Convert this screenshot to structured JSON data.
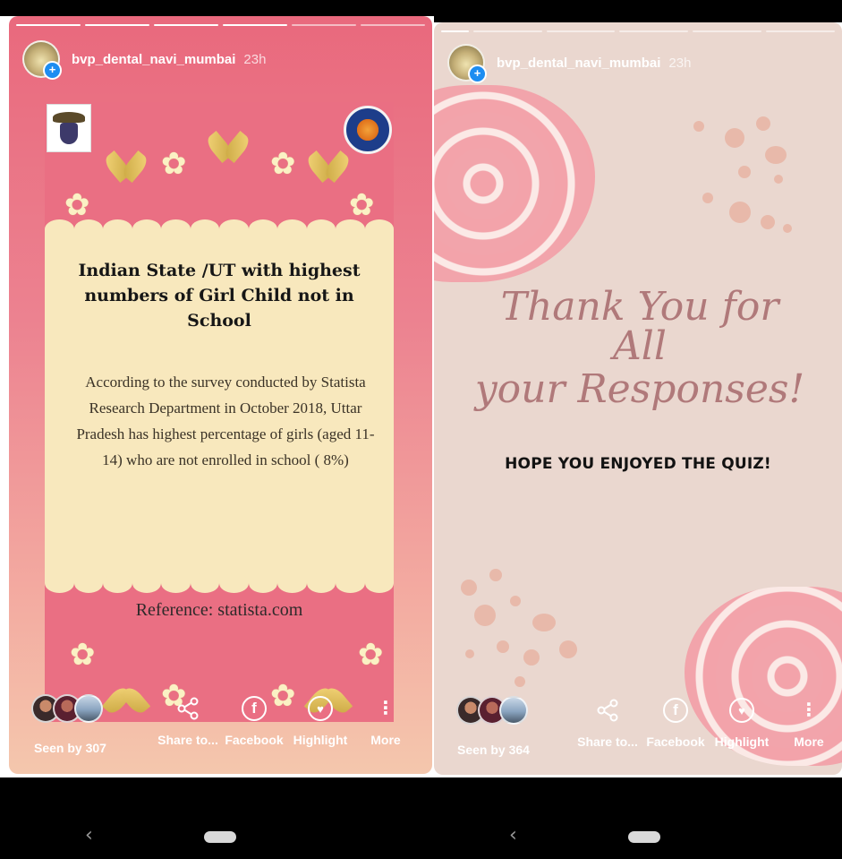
{
  "stories": [
    {
      "username": "bvp_dental_navi_mumbai",
      "time_ago": "23h",
      "poster": {
        "title": "Indian State /UT with highest numbers of Girl Child not in  School",
        "body_lines": [
          "According to the survey conducted by Statista",
          "Research Department in October 2018, Uttar",
          "Pradesh has highest percentage of girls (aged 11-",
          "14) who are not enrolled in school ( 8%)"
        ],
        "reference": "Reference: statista.com"
      },
      "seen_by": "Seen by 307",
      "actions": {
        "share": "Share to...",
        "facebook": "Facebook",
        "highlight": "Highlight",
        "more": "More"
      }
    },
    {
      "username": "bvp_dental_navi_mumbai",
      "time_ago": "23h",
      "message_line1": "Thank You for All",
      "message_line2": "your Responses!",
      "subtitle": "HOPE YOU ENJOYED THE  QUIZ!",
      "seen_by": "Seen by 364",
      "actions": {
        "share": "Share to...",
        "facebook": "Facebook",
        "highlight": "Highlight",
        "more": "More"
      }
    }
  ],
  "nav": {
    "back_glyph": "‹"
  },
  "colors": {
    "left_story_top": "#e9697d",
    "poster_pink": "#ea6f83",
    "poster_cream": "#f8e8bd",
    "right_story_bg": "#ead7cf",
    "script_text": "#b0797a",
    "badge_blue": "#1d8df1"
  }
}
